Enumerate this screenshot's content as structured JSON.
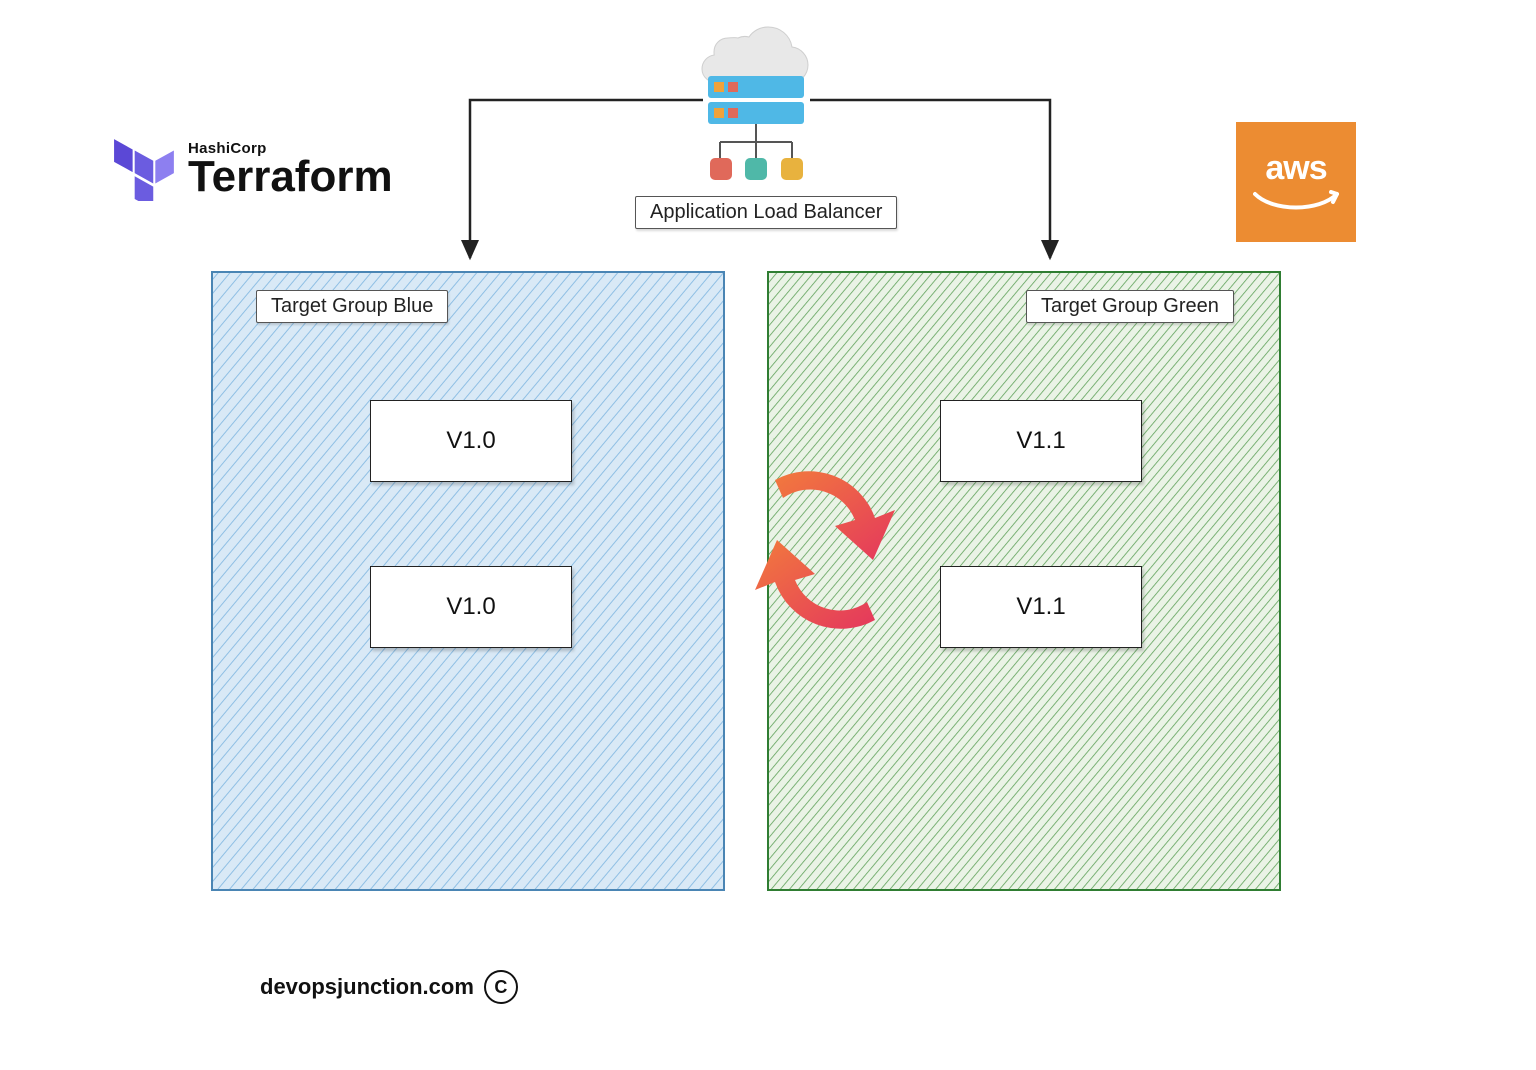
{
  "logos": {
    "terraform": {
      "vendor": "HashiCorp",
      "name": "Terraform"
    },
    "aws": {
      "label": "aws"
    }
  },
  "loadbalancer": {
    "label": "Application Load Balancer"
  },
  "groups": {
    "blue": {
      "title": "Target Group Blue",
      "nodes": [
        "V1.0",
        "V1.0"
      ],
      "color": "#6aa6d8"
    },
    "green": {
      "title": "Target Group  Green",
      "nodes": [
        "V1.1",
        "V1.1"
      ],
      "color": "#3b8a3e"
    }
  },
  "icons": {
    "swap": "swap-icon",
    "server_nodes": [
      {
        "name": "node-red",
        "color": "#e0695a"
      },
      {
        "name": "node-teal",
        "color": "#4fb8a8"
      },
      {
        "name": "node-yellow",
        "color": "#e8b23e"
      }
    ]
  },
  "footer": {
    "site": "devopsjunction.com",
    "copyright": "C"
  }
}
